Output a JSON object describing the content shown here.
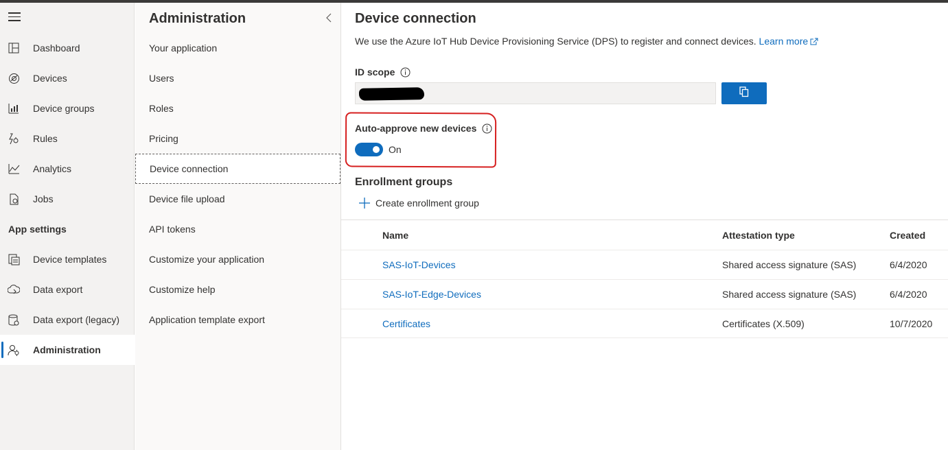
{
  "nav": {
    "items": [
      {
        "label": "Dashboard",
        "icon": "dashboard-icon"
      },
      {
        "label": "Devices",
        "icon": "devices-icon"
      },
      {
        "label": "Device groups",
        "icon": "device-groups-icon"
      },
      {
        "label": "Rules",
        "icon": "rules-icon"
      },
      {
        "label": "Analytics",
        "icon": "analytics-icon"
      },
      {
        "label": "Jobs",
        "icon": "jobs-icon"
      }
    ],
    "section_label": "App settings",
    "settings_items": [
      {
        "label": "Device templates",
        "icon": "device-templates-icon"
      },
      {
        "label": "Data export",
        "icon": "data-export-icon"
      },
      {
        "label": "Data export (legacy)",
        "icon": "data-export-legacy-icon"
      },
      {
        "label": "Administration",
        "icon": "administration-icon"
      }
    ]
  },
  "admin": {
    "title": "Administration",
    "items": [
      "Your application",
      "Users",
      "Roles",
      "Pricing",
      "Device connection",
      "Device file upload",
      "API tokens",
      "Customize your application",
      "Customize help",
      "Application template export"
    ],
    "selected": "Device connection"
  },
  "main": {
    "title": "Device connection",
    "description": "We use the Azure IoT Hub Device Provisioning Service (DPS) to register and connect devices.",
    "learn_more": "Learn more",
    "id_scope_label": "ID scope",
    "auto_approve_label": "Auto-approve new devices",
    "toggle_state": "On",
    "enrollment_title": "Enrollment groups",
    "create_label": "Create enrollment group",
    "table": {
      "headers": [
        "Name",
        "Attestation type",
        "Created"
      ],
      "rows": [
        {
          "name": "SAS-IoT-Devices",
          "type": "Shared access signature (SAS)",
          "created": "6/4/2020"
        },
        {
          "name": "SAS-IoT-Edge-Devices",
          "type": "Shared access signature (SAS)",
          "created": "6/4/2020"
        },
        {
          "name": "Certificates",
          "type": "Certificates (X.509)",
          "created": "10/7/2020"
        }
      ]
    }
  },
  "colors": {
    "accent": "#0f6cbd",
    "highlight": "#d61f1f",
    "nav_bg": "#f3f2f1"
  }
}
